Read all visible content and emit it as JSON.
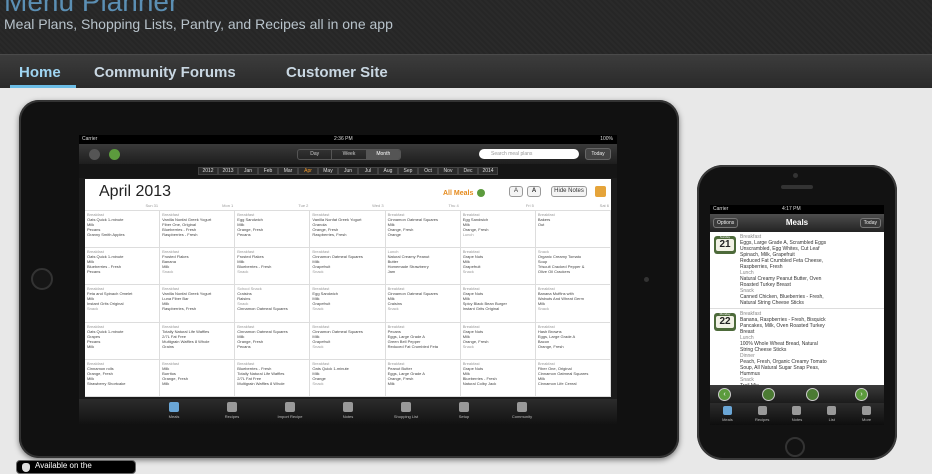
{
  "header": {
    "title": "Menu Planner",
    "tagline": "Meal Plans, Shopping Lists, Pantry, and Recipes all in one app"
  },
  "nav": {
    "items": [
      "Home",
      "Community Forums",
      "Customer Site"
    ],
    "active": "Home"
  },
  "ipad": {
    "status": {
      "carrier": "Carrier",
      "time": "2:36 PM",
      "battery": "100%"
    },
    "view_segments": [
      "Day",
      "Week",
      "Month"
    ],
    "selected_segment": "Month",
    "search_placeholder": "Search meal plans",
    "today_label": "Today",
    "months": [
      "2012",
      "2013",
      "Jan",
      "Feb",
      "Mar",
      "Apr",
      "May",
      "Jun",
      "Jul",
      "Aug",
      "Sep",
      "Oct",
      "Nov",
      "Dec",
      "2014"
    ],
    "selected_month": "Apr",
    "calendar_title": "April 2013",
    "all_meals_label": "All Meals",
    "font_small": "A",
    "font_large": "A",
    "hide_notes": "Hide Notes",
    "weekdays": [
      "Sun 31",
      "Mon 1",
      "Tue 2",
      "Wed 3",
      "Thu 4",
      "Fri 5",
      "Sat 6"
    ],
    "cells": [
      [
        "Breakfast",
        "Oats Quick 1-minute",
        "Milk",
        "Pecans",
        "Granny Smith Apples"
      ],
      [
        "Breakfast",
        "Vanilla Nonfat Greek Yogurt",
        "Fiber One, Original",
        "Blueberries - Fresh",
        "Raspberries - Fresh"
      ],
      [
        "Breakfast",
        "Egg Sandwich",
        "Milk",
        "Orange, Fresh",
        "Pecans"
      ],
      [
        "Breakfast",
        "Vanilla Nonfat Greek Yogurt",
        "Granola",
        "Orange, Fresh",
        "Raspberries, Fresh"
      ],
      [
        "Breakfast",
        "Cinnamon Oatmeal Squares",
        "Milk",
        "Orange, Fresh",
        "Orange"
      ],
      [
        "Breakfast",
        "Egg Sandwich",
        "Milk",
        "Orange, Fresh",
        "Lunch"
      ],
      [
        "Breakfast",
        "Bakers",
        "Out"
      ],
      [
        "Breakfast",
        "Oats Quick 1-minute",
        "Milk",
        "Blueberries - Fresh",
        "Pecans"
      ],
      [
        "Breakfast",
        "Frosted Flakes",
        "Banana",
        "Milk",
        "Snack"
      ],
      [
        "Breakfast",
        "Frosted Flakes",
        "Milk",
        "Blueberries - Fresh",
        "Snack"
      ],
      [
        "Breakfast",
        "Cinnamon Oatmeal Squares",
        "Milk",
        "Grapefruit",
        "Snack"
      ],
      [
        "Lunch",
        "Natural Creamy Peanut",
        "Butter",
        "Homemade Strawberry",
        "Jam"
      ],
      [
        "Breakfast",
        "Grape Nuts",
        "Milk",
        "Grapefruit",
        "Snack"
      ],
      [
        "Snack",
        "Organic Creamy Tomato",
        "Soup",
        "Triscuit Cracked Pepper &",
        "Olive Oil Crackers"
      ],
      [
        "Breakfast",
        "Feta and Spinach Omelet",
        "Milk",
        "Instant Grits Original",
        "Snack"
      ],
      [
        "Breakfast",
        "Vanilla Nonfat Greek Yogurt",
        "Luna Fiber Bar",
        "Milk",
        "Raspberries, Fresh"
      ],
      [
        "School Snack",
        "Craisins",
        "Raisins",
        "Snack",
        "Cinnamon Oatmeal Squares"
      ],
      [
        "Breakfast",
        "Egg Sandwich",
        "Milk",
        "Grapefruit",
        "Snack"
      ],
      [
        "Breakfast",
        "Cinnamon Oatmeal Squares",
        "Milk",
        "Craisins",
        "Snack"
      ],
      [
        "Breakfast",
        "Grape Nuts",
        "Milk",
        "Spicy Black Bean Burger",
        "Instant Grits Original"
      ],
      [
        "Breakfast",
        "Banana Muffins with",
        "Walnuts And Wheat Germ",
        "Milk",
        "Snack"
      ],
      [
        "Breakfast",
        "Oats Quick 1-minute",
        "Grapes",
        "Pecans",
        "Milk"
      ],
      [
        "Breakfast",
        "Totally Natural Life Waffles",
        "2/7L Fat Free",
        "Multigrain Waffles 8 Whole",
        "Grains"
      ],
      [
        "Breakfast",
        "Cinnamon Oatmeal Squares",
        "Milk",
        "Orange, Fresh",
        "Pecans"
      ],
      [
        "Breakfast",
        "Cinnamon Oatmeal Squares",
        "Milk",
        "Grapefruit",
        "Snack"
      ],
      [
        "Breakfast",
        "Pecans",
        "Eggs, Large Grade A",
        "Green Bell Pepper",
        "Reduced Fat Crumbled Feta"
      ],
      [
        "Breakfast",
        "Grape Nuts",
        "Milk",
        "Orange, Fresh",
        "Snack"
      ],
      [
        "Breakfast",
        "Hash Browns",
        "Eggs, Large Grade A",
        "Bacon",
        "Orange, Fresh"
      ],
      [
        "Breakfast",
        "Cinnamon rolls",
        "Orange, Fresh",
        "Milk",
        "Strawberry Shortcake"
      ],
      [
        "Breakfast",
        "Milk",
        "Burritos",
        "Orange, Fresh",
        "Milk"
      ],
      [
        "Breakfast",
        "Blueberries - Fresh",
        "Totally Natural Life Waffles",
        "2/7L Fat Free",
        "Multigrain Waffles 8 Whole"
      ],
      [
        "Breakfast",
        "Oats Quick 1-minute",
        "Milk",
        "Orange",
        "Snack"
      ],
      [
        "Breakfast",
        "Peanut Butter",
        "Eggs, Large Grade A",
        "Orange, Fresh",
        "Milk"
      ],
      [
        "Breakfast",
        "Grape Nuts",
        "Milk",
        "Blueberries - Fresh",
        "Natural Colby Jack"
      ],
      [
        "Breakfast",
        "Fiber One, Original",
        "Cinnamon Oatmeal Squares",
        "Milk",
        "Cinnamon Life Cereal"
      ]
    ],
    "tabs": [
      "Meals",
      "Recipes",
      "Import Recipe",
      "Notes",
      "Shopping List",
      "Setup",
      "Community"
    ],
    "active_tab": "Meals"
  },
  "iphone": {
    "status": {
      "carrier": "Carrier",
      "time": "4:17 PM"
    },
    "options_label": "Options",
    "title": "Meals",
    "today_label": "Today",
    "days": [
      {
        "weekday": "Sunday",
        "date": "21",
        "lines": [
          "Breakfast",
          "Eggs, Large Grade A, Scrambled Eggs",
          "Unscrambled, Egg Whites, Cut Leaf",
          "Spinach, Milk, Grapefruit",
          "Reduced Fat Crumbled Feta Cheese,",
          "Raspberries, Fresh",
          "Lunch",
          "Natural Creamy Peanut Butter, Oven",
          "Roasted Turkey Breast",
          "Snack",
          "Canned Chicken, Blueberries - Fresh,",
          "Natural String Cheese Sticks"
        ]
      },
      {
        "weekday": "Monday",
        "date": "22",
        "lines": [
          "Breakfast",
          "Banana, Raspberries - Fresh, Bisquick",
          "Pancakes, Milk, Oven Roasted Turkey",
          "Breast",
          "Lunch",
          "100% Whole Wheat Bread, Natural",
          "String Cheese Sticks",
          "Dinner",
          "Peach, Fresh, Organic Creamy Tomato",
          "Soup, All Natural Sugar Snap Peas,",
          "Hummus",
          "Snack",
          "Trail Mix"
        ]
      }
    ],
    "tabs": [
      "Meals",
      "Recipes",
      "Notes",
      "List",
      "More"
    ],
    "active_tab": "Meals"
  },
  "badge": {
    "text": "Available on the"
  },
  "colors": {
    "nav_active": "#9fd5f2",
    "accent_orange": "#e58a1c",
    "accent_green": "#5c9b3d"
  }
}
